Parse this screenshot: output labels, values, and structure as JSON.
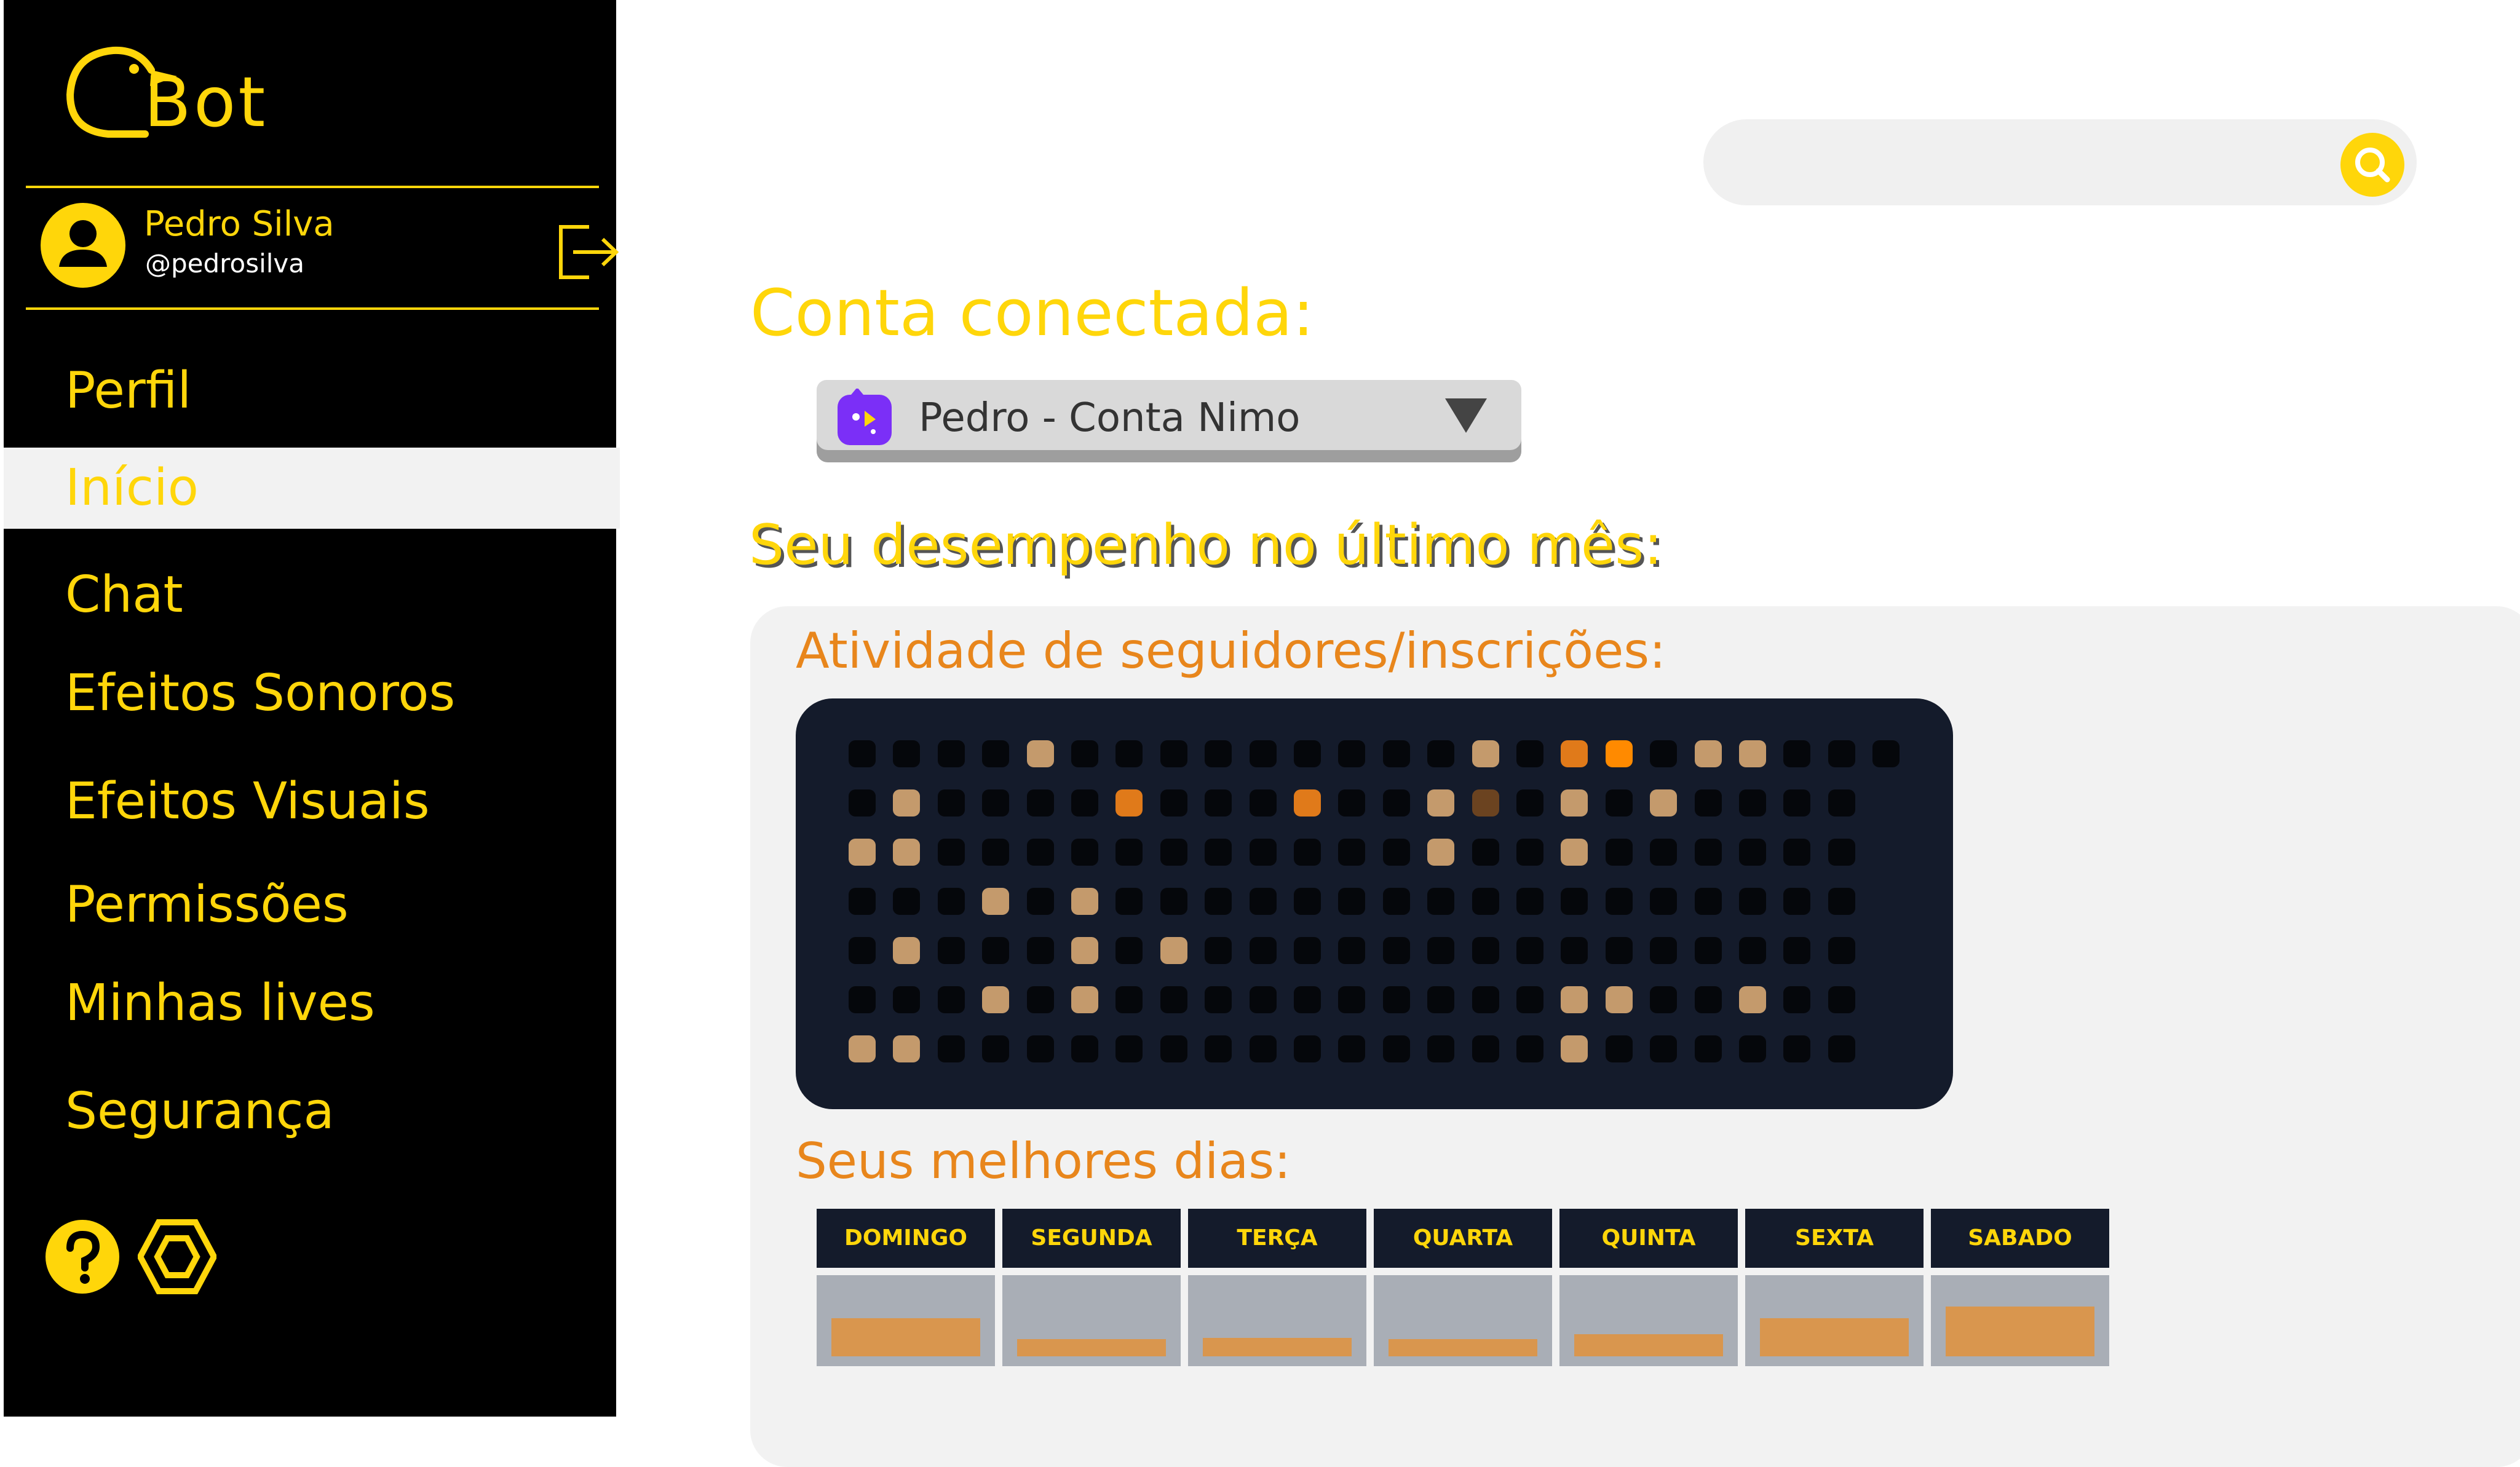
{
  "app": {
    "logo_text": "Bot",
    "brand_color": "#FFD60A",
    "accent_orange": "#E8861C"
  },
  "user": {
    "name": "Pedro Silva",
    "handle": "@pedrosilva",
    "avatar_icon": "user-avatar-icon",
    "logout_icon": "logout-icon"
  },
  "nav": {
    "items": [
      {
        "label": "Perfil",
        "active": false
      },
      {
        "label": "Início",
        "active": true
      },
      {
        "label": "Chat",
        "active": false
      },
      {
        "label": "Efeitos Sonoros",
        "active": false
      },
      {
        "label": "Efeitos Visuais",
        "active": false
      },
      {
        "label": "Permissões",
        "active": false
      },
      {
        "label": "Minhas lives",
        "active": false
      },
      {
        "label": "Segurança",
        "active": false
      }
    ],
    "footer_icons": [
      "help-icon",
      "settings-icon"
    ]
  },
  "search": {
    "placeholder": "",
    "icon": "search-icon"
  },
  "account": {
    "title": "Conta conectada:",
    "selected": "Pedro - Conta Nimo",
    "icon": "nimo-icon"
  },
  "performance": {
    "title": "Seu desempenho no último mês:",
    "activity_label": "Atividade de seguidores/inscrições:",
    "best_days_label": "Seus melhores dias:"
  },
  "activity_grid": {
    "rows": 7,
    "cols": 23,
    "colors": {
      "0": "#05070B",
      "1": "#C49A6C",
      "2": "#E07A1A",
      "3": "#FF8A00",
      "4": "#6B4320"
    },
    "cells": [
      [
        0,
        0,
        0,
        0,
        1,
        0,
        0,
        0,
        0,
        0,
        0,
        0,
        0,
        0,
        1,
        0,
        2,
        3,
        0,
        1,
        1,
        0,
        0,
        0
      ],
      [
        0,
        1,
        0,
        0,
        0,
        0,
        2,
        0,
        0,
        0,
        2,
        0,
        0,
        1,
        4,
        0,
        1,
        0,
        1,
        0,
        0,
        0,
        0
      ],
      [
        1,
        1,
        0,
        0,
        0,
        0,
        0,
        0,
        0,
        0,
        0,
        0,
        0,
        1,
        0,
        0,
        1,
        0,
        0,
        0,
        0,
        0,
        0
      ],
      [
        0,
        0,
        0,
        1,
        0,
        1,
        0,
        0,
        0,
        0,
        0,
        0,
        0,
        0,
        0,
        0,
        0,
        0,
        0,
        0,
        0,
        0,
        0
      ],
      [
        0,
        1,
        0,
        0,
        0,
        1,
        0,
        1,
        0,
        0,
        0,
        0,
        0,
        0,
        0,
        0,
        0,
        0,
        0,
        0,
        0,
        0,
        0
      ],
      [
        0,
        0,
        0,
        1,
        0,
        1,
        0,
        0,
        0,
        0,
        0,
        0,
        0,
        0,
        0,
        0,
        1,
        1,
        0,
        0,
        1,
        0,
        0
      ],
      [
        1,
        1,
        0,
        0,
        0,
        0,
        0,
        0,
        0,
        0,
        0,
        0,
        0,
        0,
        0,
        0,
        1,
        0,
        0,
        0,
        0,
        0,
        0
      ]
    ]
  },
  "best_days": {
    "days": [
      "DOMINGO",
      "SEGUNDA",
      "TERÇA",
      "QUARTA",
      "QUINTA",
      "SEXTA",
      "SABADO"
    ],
    "levels": [
      0.55,
      0.25,
      0.27,
      0.25,
      0.32,
      0.55,
      0.72
    ]
  }
}
